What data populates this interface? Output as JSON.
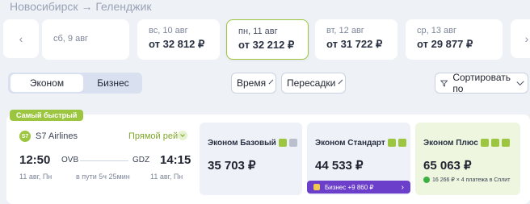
{
  "route": {
    "from": "Новосибирск",
    "arrow": "→",
    "to": "Геленджик"
  },
  "dates": [
    {
      "day": "сб, 9 авг",
      "price": ""
    },
    {
      "day": "вс, 10 авг",
      "price": "от 32 812 ₽"
    },
    {
      "day": "пн, 11 авг",
      "price": "от 32 212 ₽",
      "selected": true
    },
    {
      "day": "вт, 12 авг",
      "price": "от 31 722 ₽"
    },
    {
      "day": "ср, 13 авг",
      "price": "от 29 877 ₽"
    }
  ],
  "nav": {
    "prev_icon": "chevron-left-icon",
    "next_icon": "chevron-right-icon",
    "prev_glyph": "‹",
    "next_glyph": "›"
  },
  "class_toggle": {
    "economy": "Эконом",
    "business": "Бизнес"
  },
  "filters": {
    "time": "Время",
    "transfers": "Пересадки",
    "sort": "Сортировать по"
  },
  "ticket": {
    "badge": "Самый быстрый",
    "airline": {
      "logo": "S7",
      "name": "S7 Airlines"
    },
    "direct": "Прямой рейс",
    "departure": {
      "time": "12:50",
      "iata": "OVB",
      "date": "11 авг, Пн"
    },
    "arrival": {
      "time": "14:15",
      "iata": "GDZ",
      "date": "11 авг, Пн"
    },
    "duration": "в пути 5ч 25мин",
    "fares": [
      {
        "name": "Эконом Базовый",
        "price": "35 703 ₽"
      },
      {
        "name": "Эконом Стандарт",
        "price": "44 533 ₽",
        "upsell": "Бизнес +9 860 ₽"
      },
      {
        "name": "Эконом Плюс",
        "price": "65 063 ₽",
        "split": "16 266 ₽ × 4 платежа в Сплит"
      }
    ]
  },
  "colors": {
    "accent_green": "#9cc63f",
    "upsell_purple": "#6b3fc9",
    "split_green": "#3cb043"
  }
}
